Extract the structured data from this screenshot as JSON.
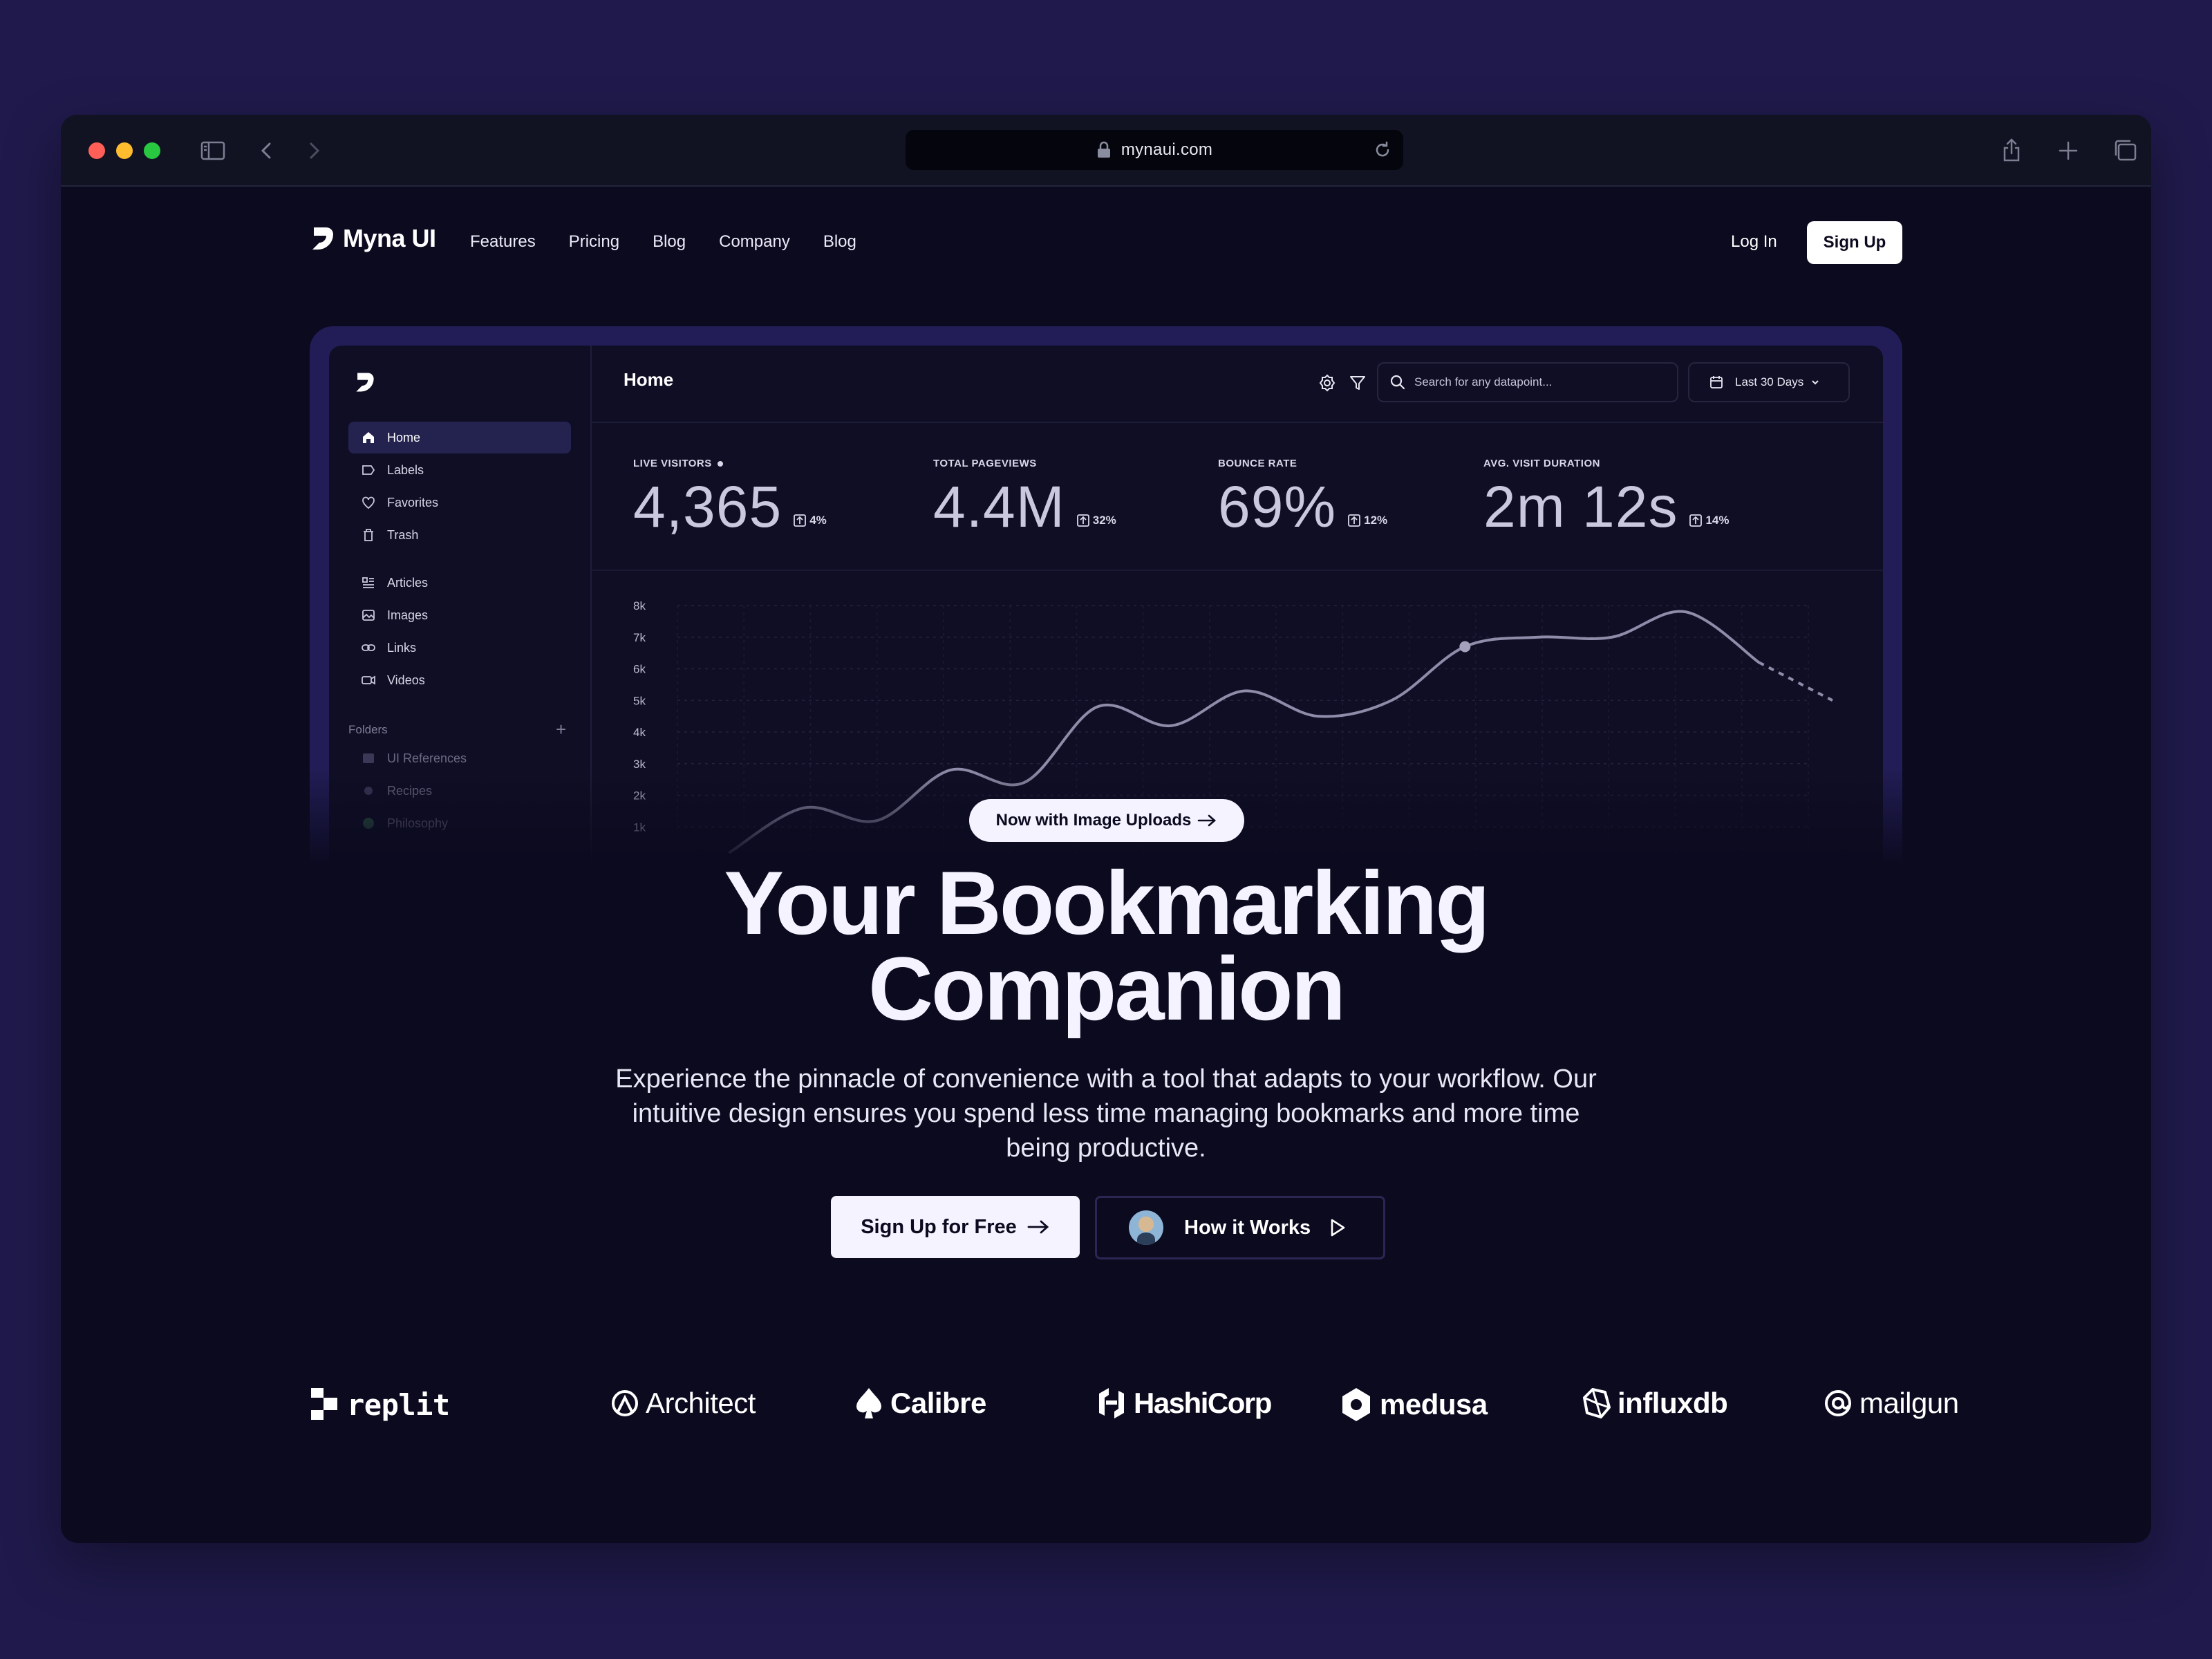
{
  "browser": {
    "url": "mynaui.com",
    "traffic_lights": [
      "#ff5f57",
      "#febc2e",
      "#28c840"
    ]
  },
  "site": {
    "brand": "Myna UI",
    "nav": [
      "Features",
      "Pricing",
      "Blog",
      "Company",
      "Blog"
    ],
    "login": "Log In",
    "signup": "Sign Up"
  },
  "dashboard": {
    "title": "Home",
    "search_placeholder": "Search for any datapoint...",
    "date_range": "Last 30 Days",
    "sidebar": {
      "items": [
        {
          "label": "Home",
          "icon": "home-icon",
          "active": true
        },
        {
          "label": "Labels",
          "icon": "label-icon"
        },
        {
          "label": "Favorites",
          "icon": "heart-icon"
        },
        {
          "label": "Trash",
          "icon": "trash-icon"
        },
        {
          "label": "Articles",
          "icon": "articles-icon"
        },
        {
          "label": "Images",
          "icon": "image-icon"
        },
        {
          "label": "Links",
          "icon": "link-icon"
        },
        {
          "label": "Videos",
          "icon": "video-icon"
        }
      ],
      "folders_heading": "Folders",
      "folders": [
        "UI References",
        "Recipes",
        "Philosophy"
      ]
    },
    "stats": [
      {
        "label": "LIVE VISITORS",
        "value": "4,365",
        "delta": "4%",
        "live": true
      },
      {
        "label": "TOTAL PAGEVIEWS",
        "value": "4.4M",
        "delta": "32%"
      },
      {
        "label": "BOUNCE RATE",
        "value": "69%",
        "delta": "12%"
      },
      {
        "label": "AVG. VISIT DURATION",
        "value": "2m 12s",
        "delta": "14%"
      }
    ]
  },
  "chart_data": {
    "type": "line",
    "y_tick_labels": [
      "8k",
      "7k",
      "6k",
      "5k",
      "4k",
      "3k",
      "2k",
      "1k"
    ],
    "ylim": [
      0,
      8000
    ],
    "grid": true,
    "series": [
      {
        "values": [
          200,
          1600,
          1200,
          2800,
          2400,
          4800,
          4200,
          5300,
          4500,
          5000,
          6700,
          7000,
          7000,
          7800,
          6200,
          5000
        ]
      }
    ],
    "highlight_point_index": 10,
    "dashed_tail_from_index": 14
  },
  "hero": {
    "pill": "Now with Image Uploads",
    "title_line1": "Your Bookmarking",
    "title_line2": "Companion",
    "subtitle": "Experience the pinnacle of convenience with a tool that adapts to your workflow. Our intuitive design ensures you spend less time managing bookmarks and more time being productive.",
    "cta_primary": "Sign Up for Free",
    "cta_secondary": "How it Works"
  },
  "logos": [
    "replit",
    "Architect",
    "Calibre",
    "HashiCorp",
    "medusa",
    "influxdb",
    "mailgun"
  ]
}
